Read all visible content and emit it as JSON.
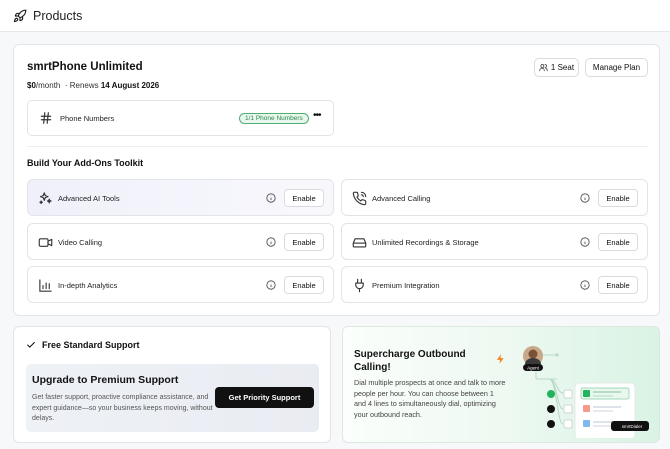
{
  "header": {
    "title": "Products"
  },
  "plan": {
    "name": "smrtPhone Unlimited",
    "price": "$0",
    "period": "/month",
    "renews_label": "Renews",
    "renews_date": "14 August 2026",
    "seat_label": "1 Seat",
    "manage_label": "Manage Plan"
  },
  "phone_numbers": {
    "label": "Phone Numbers",
    "badge": "1/1 Phone Numbers",
    "more": "•••"
  },
  "addons": {
    "title": "Build Your Add-Ons Toolkit",
    "enable_label": "Enable",
    "items": [
      {
        "name": "Advanced AI Tools",
        "icon": "sparkles-icon"
      },
      {
        "name": "Advanced Calling",
        "icon": "phone-call-icon"
      },
      {
        "name": "Video Calling",
        "icon": "video-icon"
      },
      {
        "name": "Unlimited Recordings & Storage",
        "icon": "storage-icon"
      },
      {
        "name": "In-depth Analytics",
        "icon": "chart-icon"
      },
      {
        "name": "Premium Integration",
        "icon": "plug-icon"
      }
    ]
  },
  "support": {
    "current": "Free Standard Support",
    "upgrade_title": "Upgrade to Premium Support",
    "upgrade_desc": "Get faster support, proactive compliance assistance, and expert guidance—so your business keeps moving, without delays.",
    "cta": "Get Priority Support"
  },
  "promo": {
    "title": "Supercharge Outbound Calling!",
    "desc": "Dial multiple prospects at once and talk to more people per hour. You can choose between 1 and 4 lines to simultaneously dial, optimizing your outbound reach.",
    "agent_label": "Agent",
    "dialer_label": "smrtDialer"
  },
  "colors": {
    "accent_green": "#2d8a4e",
    "bolt_orange": "#f5821f",
    "button_dark": "#111111"
  }
}
